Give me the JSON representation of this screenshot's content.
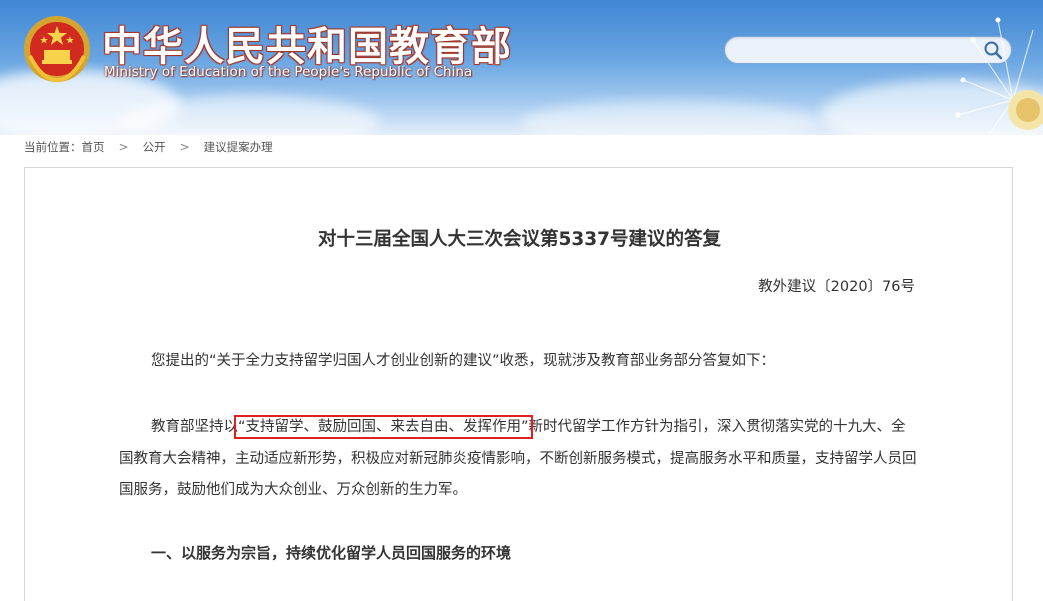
{
  "header": {
    "title_cn": "中华人民共和国教育部",
    "title_en": "Ministry of Education of the People's Republic of China",
    "emblem_icon": "national-emblem-icon",
    "search": {
      "value": "",
      "placeholder": ""
    }
  },
  "breadcrumb": {
    "prefix": "当前位置：",
    "items": [
      "首页",
      "公开",
      "建议提案办理"
    ],
    "separator": ">"
  },
  "article": {
    "title": "对十三届全国人大三次会议第5337号建议的答复",
    "doc_number": "教外建议〔2020〕76号",
    "para1": "您提出的“关于全力支持留学归国人才创业创新的建议”收悉，现就涉及教育部业务部分答复如下：",
    "para2_before": "教育部坚持以",
    "para2_highlight": "“支持留学、鼓励回国、来去自由、发挥作用”",
    "para2_after": "新时代留学工作方针为指引，深入贯彻落实党的十九大、全国教育大会精神，主动适应新形势，积极应对新冠肺炎疫情影响，不断创新服务模式，提高服务水平和质量，支持留学人员回国服务，鼓励他们成为大众创业、万众创新的生力军。",
    "section1": "一、以服务为宗旨，持续优化留学人员回国服务的环境"
  },
  "colors": {
    "highlight_border": "#e02020",
    "header_sky": "#3f86d4",
    "title_red": "#c0392b"
  }
}
